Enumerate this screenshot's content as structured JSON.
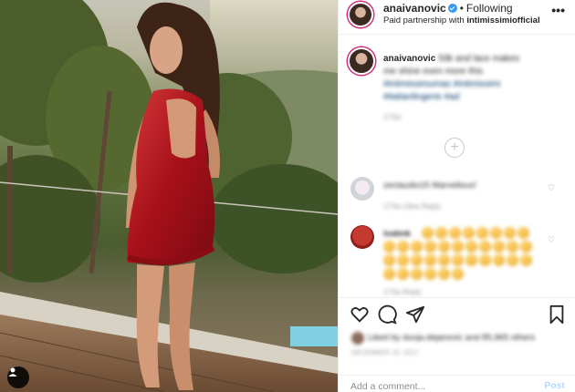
{
  "post": {
    "username": "anaivanovic",
    "follow_dot": "•",
    "follow_label": "Following",
    "partner_prefix": "Paid partnership with",
    "partner_name": "intimissimiofficial",
    "more_icon_label": "•••"
  },
  "caption": {
    "username": "anaivanovic",
    "text_lines": [
      "Silk and lace makes",
      "me shine even more this",
      "#intimissimumas #intimissimi",
      "#italianlingerie #ad"
    ],
    "time": "172w"
  },
  "comments": [
    {
      "text": "zeclaudio15 Marvellous!",
      "meta": "172w  Likes  Reply"
    },
    {
      "username": "ivabnk",
      "meta": "172w  Reply",
      "emoji_count": 36
    }
  ],
  "actions": {
    "likes_text": "Liked by dunja.dejanovic and 85,965 others",
    "date": "DECEMBER 10, 2017"
  },
  "comment_input": {
    "placeholder": "Add a comment...",
    "post_label": "Post"
  },
  "colors": {
    "verified": "#3897f0",
    "link": "#00376b",
    "post_button": "#b3dbff",
    "dress": "#b0121b"
  },
  "icons": [
    "verified-icon",
    "more-options-icon",
    "load-more-icon",
    "heart-icon",
    "comment-icon",
    "share-icon",
    "bookmark-icon",
    "tag-user-icon"
  ]
}
